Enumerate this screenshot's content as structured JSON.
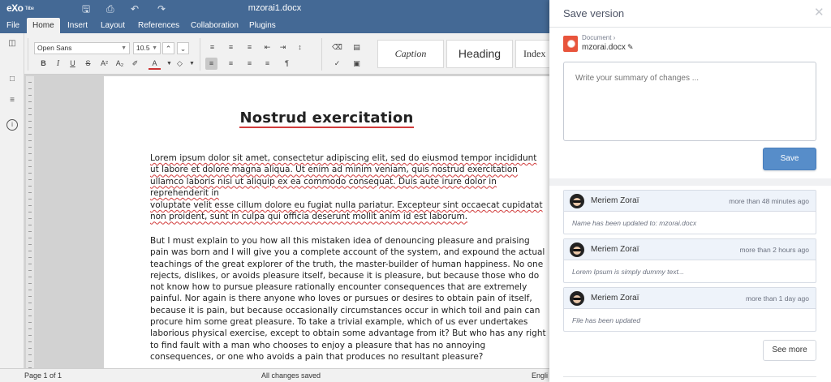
{
  "app": {
    "logo": "eXo",
    "logo_sub": "Tribe",
    "doc_title": "mzorai1.docx"
  },
  "menu": {
    "tabs": [
      "File",
      "Home",
      "Insert",
      "Layout",
      "References",
      "Collaboration",
      "Plugins"
    ],
    "active": "Home"
  },
  "toolbar": {
    "font_family": "Open Sans",
    "font_size": "10.5",
    "styles": [
      "Caption",
      "Heading",
      "Index"
    ]
  },
  "document": {
    "title": "Nostrud exercitation",
    "para1": "Lorem ipsum dolor sit amet, consectetur adipiscing elit, sed do eiusmod tempor incididunt ut labore et dolore magna aliqua. Ut enim ad minim veniam, quis nostrud exercitation ullamco laboris nisi ut aliquip ex ea commodo consequat. Duis aute irure dolor in reprehenderit in",
    "para2": "voluptate velit esse cillum dolore eu fugiat nulla pariatur. Excepteur sint occaecat cupidatat non proident, sunt in culpa qui officia deserunt mollit anim id est laborum.",
    "para3": "But I must explain to you how all this mistaken idea of denouncing pleasure and praising pain was born and I will give you a complete account of the system, and expound the actual teachings of the great explorer of the truth, the master-builder of human happiness. No one rejects, dislikes, or avoids pleasure itself, because it is pleasure, but because those who do not know how to pursue pleasure rationally encounter consequences that are extremely painful. Nor again is there anyone who loves or pursues or desires to obtain pain of itself, because it is pain, but because occasionally circumstances occur in which toil and pain can procure him some great pleasure. To take a trivial example, which of us ever undertakes laborious physical exercise, except to obtain some advantage from it? But who has any right to find fault with a man who chooses to enjoy a pleasure that has no annoying consequences, or one who avoids a pain that produces no resultant pleasure?"
  },
  "status": {
    "page": "Page 1 of 1",
    "saved": "All changes saved",
    "language": "Engli"
  },
  "drawer": {
    "title": "Save version",
    "breadcrumb": "Document ›",
    "filename": "mzorai.docx",
    "summary_placeholder": "Write your summary of changes ...",
    "save_label": "Save",
    "see_more_label": "See more",
    "versions": [
      {
        "author": "Meriem Zoraï",
        "time": "more than 48 minutes ago",
        "note": "Name has been updated to: mzorai.docx"
      },
      {
        "author": "Meriem Zoraï",
        "time": "more than 2 hours ago",
        "note": "Lorem Ipsum is simply dummy text..."
      },
      {
        "author": "Meriem Zoraï",
        "time": "more than 1 day ago",
        "note": "File has been updated"
      }
    ]
  },
  "colors": {
    "header_blue": "#446995",
    "primary_button": "#578dc9",
    "spellcheck_red": "#d13b3b",
    "doc_icon": "#e8543c"
  },
  "icons": {
    "titlebar": [
      "save-icon",
      "print-icon",
      "undo-icon",
      "redo-icon"
    ],
    "leftpanel": [
      "search-icon",
      "comment-icon",
      "navigation-icon",
      "info-icon"
    ],
    "drawer": [
      "close-icon",
      "document-icon",
      "pencil-icon"
    ]
  }
}
